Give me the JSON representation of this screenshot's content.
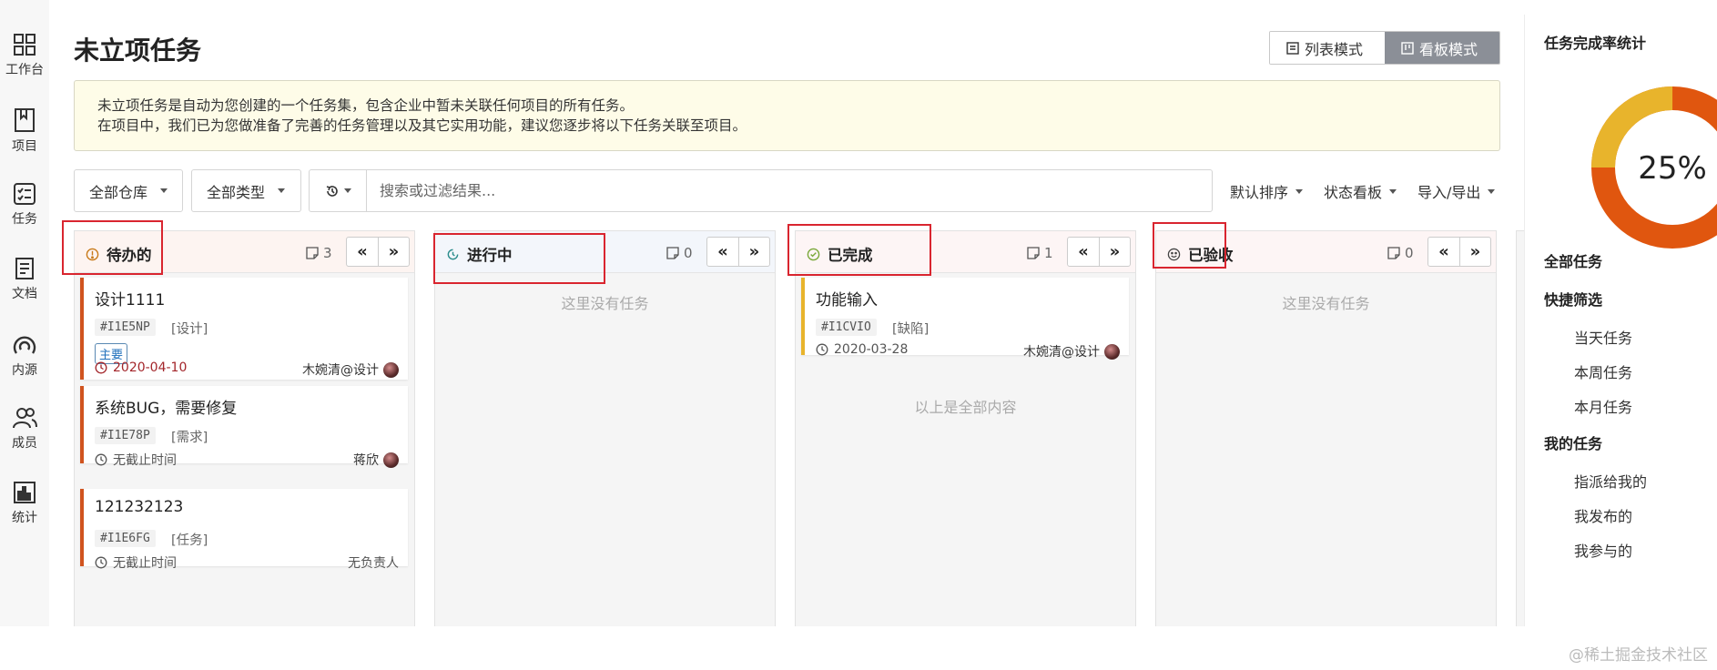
{
  "nav": [
    {
      "label": "工作台",
      "icon": "dashboard-icon"
    },
    {
      "label": "项目",
      "icon": "book-icon"
    },
    {
      "label": "任务",
      "icon": "checklist-icon"
    },
    {
      "label": "文档",
      "icon": "document-icon"
    },
    {
      "label": "内源",
      "icon": "inner-source-icon"
    },
    {
      "label": "成员",
      "icon": "members-icon"
    },
    {
      "label": "统计",
      "icon": "bar-chart-icon"
    }
  ],
  "page": {
    "title": "未立项任务"
  },
  "mode": {
    "list": "列表模式",
    "board": "看板模式"
  },
  "notice": {
    "line1": "未立项任务是自动为您创建的一个任务集，包含企业中暂未关联任何项目的所有任务。",
    "line2": "在项目中，我们已为您做准备了完善的任务管理以及其它实用功能，建议您逐步将以下任务关联至项目。"
  },
  "filters": {
    "repo": "全部仓库",
    "type": "全部类型",
    "search_placeholder": "搜索或过滤结果...",
    "sort": "默认排序",
    "status_board": "状态看板",
    "import_export": "导入/导出"
  },
  "columns": [
    {
      "title": "待办的",
      "count": "3",
      "empty": ""
    },
    {
      "title": "进行中",
      "count": "0",
      "empty": "这里没有任务"
    },
    {
      "title": "已完成",
      "count": "1",
      "empty": "",
      "end": "以上是全部内容"
    },
    {
      "title": "已验收",
      "count": "0",
      "empty": "这里没有任务"
    }
  ],
  "cards": {
    "todo": [
      {
        "title": "设计1111",
        "code": "#I1E5NP",
        "type": "[设计]",
        "tag": "主要",
        "date": "2020-04-10",
        "owner": "木婉清@设计"
      },
      {
        "title": "系统BUG，需要修复",
        "code": "#I1E78P",
        "type": "[需求]",
        "date": "无截止时间",
        "owner": "蒋欣"
      },
      {
        "title": "121232123",
        "code": "#I1E6FG",
        "type": "[任务]",
        "date": "无截止时间",
        "owner": "无负责人"
      }
    ],
    "done": [
      {
        "title": "功能输入",
        "code": "#I1CVIO",
        "type": "[缺陷]",
        "date": "2020-03-28",
        "owner": "木婉清@设计"
      }
    ]
  },
  "arrows": {
    "left": "«",
    "right": "»"
  },
  "stats": {
    "title": "任务完成率统计",
    "percent_label": "25%",
    "percent": 25,
    "colors": {
      "done": "#e8b42c",
      "remaining": "#e0560f"
    }
  },
  "rightnav": {
    "all": "全部任务",
    "quick": "快捷筛选",
    "quick_items": [
      "当天任务",
      "本周任务",
      "本月任务"
    ],
    "mine": "我的任务",
    "mine_items": [
      "指派给我的",
      "我发布的",
      "我参与的"
    ]
  },
  "watermark": "@稀土掘金技术社区"
}
